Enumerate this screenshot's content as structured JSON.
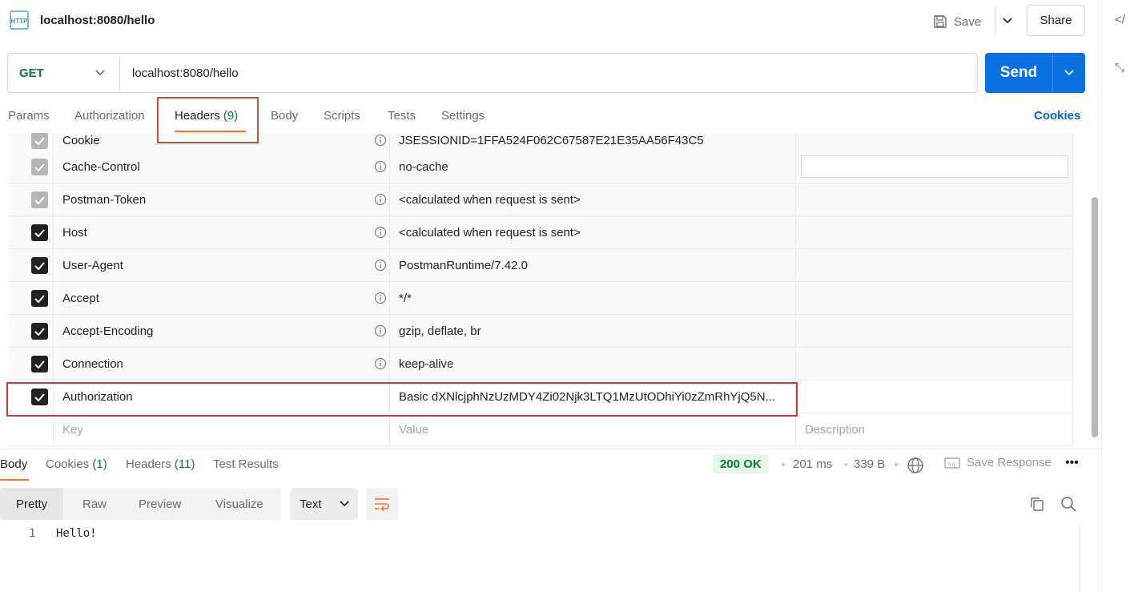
{
  "request": {
    "title": "localhost:8080/hello",
    "icon_text": "HTTP",
    "save_label": "Save",
    "share_label": "Share",
    "method": "GET",
    "url": "localhost:8080/hello",
    "send_label": "Send"
  },
  "request_tabs": {
    "params": "Params",
    "authorization": "Authorization",
    "headers": "Headers",
    "headers_count": "(9)",
    "body": "Body",
    "scripts": "Scripts",
    "tests": "Tests",
    "settings": "Settings",
    "cookies": "Cookies"
  },
  "headers": {
    "rows": [
      {
        "key": "Cookie",
        "value": "JSESSIONID=1FFA524F062C67587E21E35AA56F43C5",
        "checked": "dim"
      },
      {
        "key": "Cache-Control",
        "value": "no-cache",
        "checked": "dim"
      },
      {
        "key": "Postman-Token",
        "value": "<calculated when request is sent>",
        "checked": "dim"
      },
      {
        "key": "Host",
        "value": "<calculated when request is sent>",
        "checked": "on"
      },
      {
        "key": "User-Agent",
        "value": "PostmanRuntime/7.42.0",
        "checked": "on"
      },
      {
        "key": "Accept",
        "value": "*/*",
        "checked": "on"
      },
      {
        "key": "Accept-Encoding",
        "value": "gzip, deflate, br",
        "checked": "on"
      },
      {
        "key": "Connection",
        "value": "keep-alive",
        "checked": "on"
      },
      {
        "key": "Authorization",
        "value": "Basic dXNlcjphNzUzMDY4Zi02Njk3LTQ1MzUtODhiYi0zZmRhYjQ5N...",
        "checked": "on"
      }
    ],
    "placeholder_key": "Key",
    "placeholder_value": "Value",
    "placeholder_description": "Description"
  },
  "response": {
    "tabs": {
      "body": "Body",
      "cookies": "Cookies",
      "cookies_count": "(1)",
      "headers": "Headers",
      "headers_count": "(11)",
      "test_results": "Test Results"
    },
    "status": "200 OK",
    "time": "201 ms",
    "size": "339 B",
    "save_response": "Save Response",
    "views": {
      "pretty": "Pretty",
      "raw": "Raw",
      "preview": "Preview",
      "visualize": "Visualize"
    },
    "format": "Text",
    "code": {
      "line_number": "1",
      "text": "Hello!"
    }
  },
  "colors": {
    "accent": "#ff6c37",
    "send": "#0b6fe0",
    "method_get": "#0c7a37",
    "highlight_red": "#d0353b"
  }
}
